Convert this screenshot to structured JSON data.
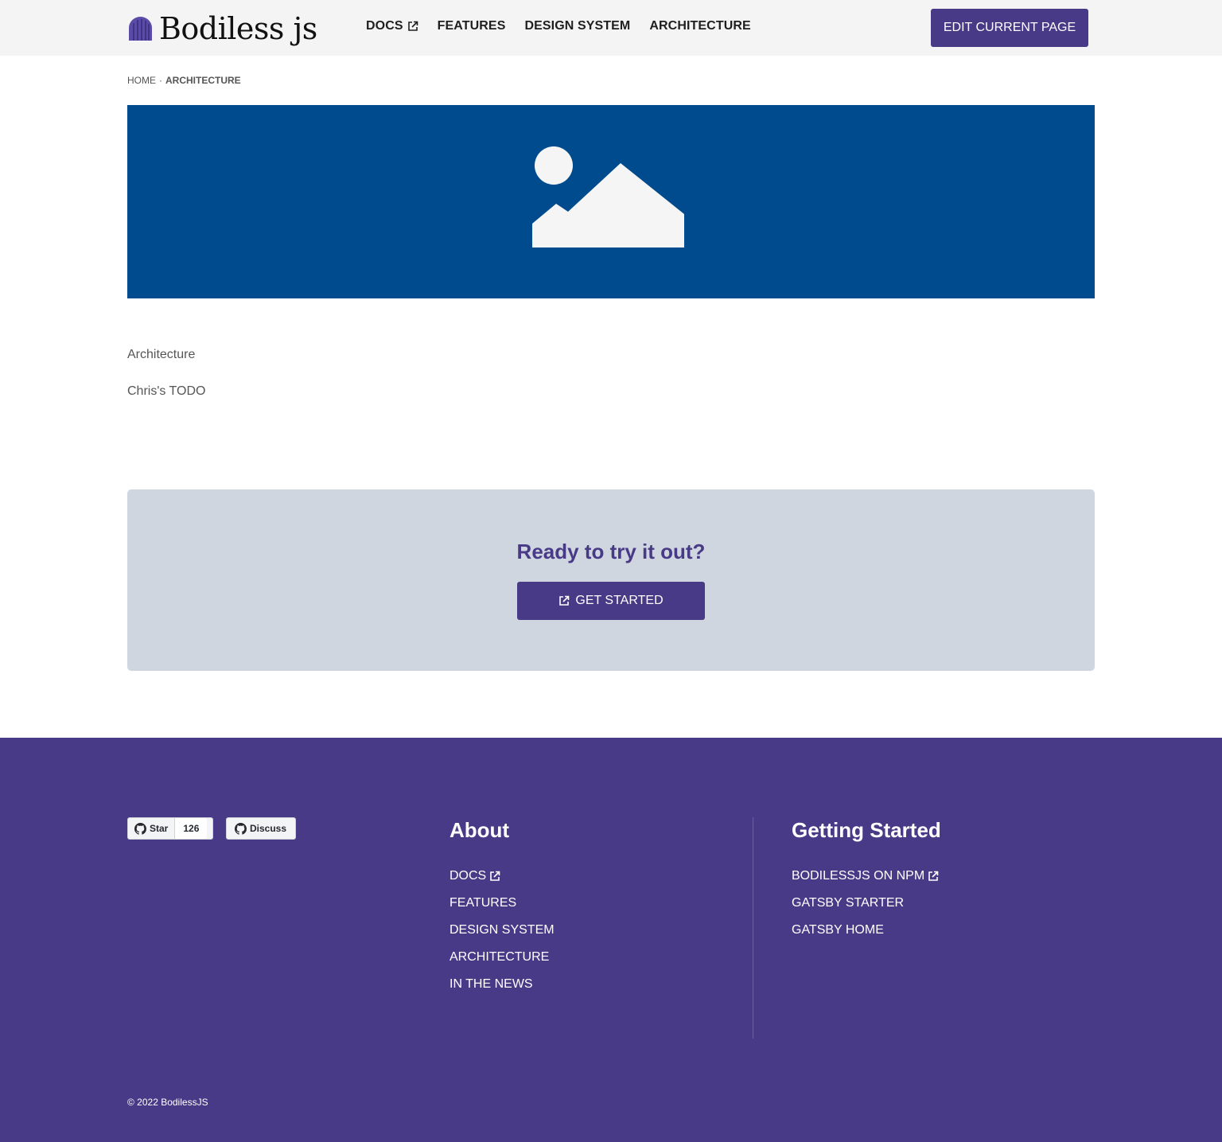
{
  "header": {
    "logo_text": "Bodiless js",
    "nav": [
      {
        "label": "DOCS",
        "external": true
      },
      {
        "label": "FEATURES",
        "external": false
      },
      {
        "label": "DESIGN SYSTEM",
        "external": false
      },
      {
        "label": "ARCHITECTURE",
        "external": false
      }
    ],
    "edit_button": "EDIT CURRENT PAGE"
  },
  "breadcrumb": {
    "home": "HOME",
    "separator": "·",
    "current": "ARCHITECTURE"
  },
  "hero": {
    "icon": "image-placeholder-icon",
    "background": "#004b8d"
  },
  "content": {
    "paragraphs": [
      "Architecture",
      "Chris's TODO"
    ]
  },
  "cta": {
    "title": "Ready to try it out?",
    "button": "GET STARTED"
  },
  "footer": {
    "github": {
      "star_label": "Star",
      "star_count": "126",
      "discuss_label": "Discuss"
    },
    "about": {
      "title": "About",
      "links": [
        {
          "label": "DOCS",
          "external": true
        },
        {
          "label": "FEATURES",
          "external": false
        },
        {
          "label": "DESIGN SYSTEM",
          "external": false
        },
        {
          "label": "ARCHITECTURE",
          "external": false
        },
        {
          "label": "IN THE NEWS",
          "external": false
        }
      ]
    },
    "getting_started": {
      "title": "Getting Started",
      "links": [
        {
          "label": "BODILESSJS ON NPM",
          "external": true
        },
        {
          "label": "GATSBY STARTER",
          "external": false
        },
        {
          "label": "GATSBY HOME",
          "external": false
        }
      ]
    },
    "copyright": "©  2022 BodilessJS"
  },
  "colors": {
    "brand_purple": "#483a87",
    "header_bg": "#f4f4f4",
    "hero_blue": "#004b8d",
    "cta_bg": "#cfd6df"
  }
}
